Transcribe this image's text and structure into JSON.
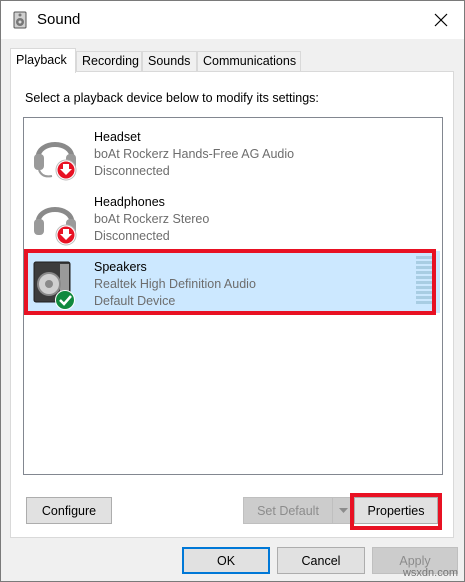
{
  "window": {
    "title": "Sound"
  },
  "tabs": [
    {
      "label": "Playback",
      "active": true
    },
    {
      "label": "Recording",
      "active": false
    },
    {
      "label": "Sounds",
      "active": false
    },
    {
      "label": "Communications",
      "active": false
    }
  ],
  "instruction": "Select a playback device below to modify its settings:",
  "devices": [
    {
      "name": "Headset",
      "description": "boAt Rockerz Hands-Free AG Audio",
      "status": "Disconnected",
      "icon": "headset-icon",
      "badge": "disconnected-arrow-icon"
    },
    {
      "name": "Headphones",
      "description": "boAt Rockerz Stereo",
      "status": "Disconnected",
      "icon": "headphones-icon",
      "badge": "disconnected-arrow-icon"
    },
    {
      "name": "Speakers",
      "description": "Realtek High Definition Audio",
      "status": "Default Device",
      "icon": "speakers-icon",
      "badge": "default-check-icon",
      "selected": true
    }
  ],
  "buttons": {
    "configure": "Configure",
    "set_default": "Set Default",
    "properties": "Properties",
    "ok": "OK",
    "cancel": "Cancel",
    "apply": "Apply"
  },
  "colors": {
    "selection": "#cce8ff",
    "highlight_outline": "#e81123",
    "badge_red": "#e81123",
    "badge_green": "#10893e",
    "accent": "#0078d7"
  },
  "watermark": "wsxdn.com"
}
